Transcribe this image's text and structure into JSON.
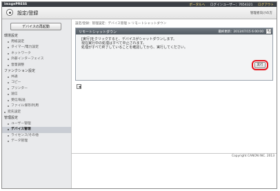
{
  "header": {
    "brand": "imagePRESS",
    "portal_link": "ポータルへ",
    "login_user": "ログインユーザー：7654321",
    "logout": "ログアウト"
  },
  "titlebar": {
    "title": "設定/登録",
    "help": "管理者向けの方"
  },
  "sidebar": {
    "device_button": "デバイスの再起動",
    "menu": [
      {
        "type": "cat",
        "label": "環境設定"
      },
      {
        "type": "item",
        "label": "用紙設定"
      },
      {
        "type": "item",
        "label": "タイマー/電力設定"
      },
      {
        "type": "item",
        "label": "ネットワーク"
      },
      {
        "type": "item",
        "label": "外部インターフェイス"
      },
      {
        "type": "item",
        "label": "音量調整"
      },
      {
        "type": "cat",
        "label": "ファンクション設定"
      },
      {
        "type": "item",
        "label": "共通"
      },
      {
        "type": "item",
        "label": "コピー"
      },
      {
        "type": "item",
        "label": "プリンター"
      },
      {
        "type": "item",
        "label": "送信"
      },
      {
        "type": "item",
        "label": "受信/転送"
      },
      {
        "type": "item",
        "label": "ファイル保存/利用"
      },
      {
        "type": "item_top",
        "label": "宛先設定"
      },
      {
        "type": "cat",
        "label": "管理設定"
      },
      {
        "type": "item",
        "label": "ユーザー管理"
      },
      {
        "type": "item_active",
        "label": "デバイス管理"
      },
      {
        "type": "item",
        "label": "ライセンス/その他"
      },
      {
        "type": "item",
        "label": "データ管理"
      }
    ]
  },
  "main": {
    "breadcrumb": "設定/登録：管理設定：デバイス管理 > リモートシャットダウン",
    "panel": {
      "title": "リモートシャットダウン",
      "last_updated": "最終更新：2013/07/15 6:00:00",
      "body_lines": [
        "[実行]をクリックすると、デバイスがシャットダウンします。",
        "現在実行中の処理はすべて中止されます。",
        "処理がすべて終了していることを確認してから、実行してください。"
      ],
      "exec_button": "実行"
    },
    "copyright": "Copyright CANON INC. 2013"
  },
  "colors": {
    "header_bg": "#3b3f45",
    "panel_head": "#5f676f",
    "highlight": "#e4121b",
    "sidebar_bg": "#e9eaec"
  }
}
